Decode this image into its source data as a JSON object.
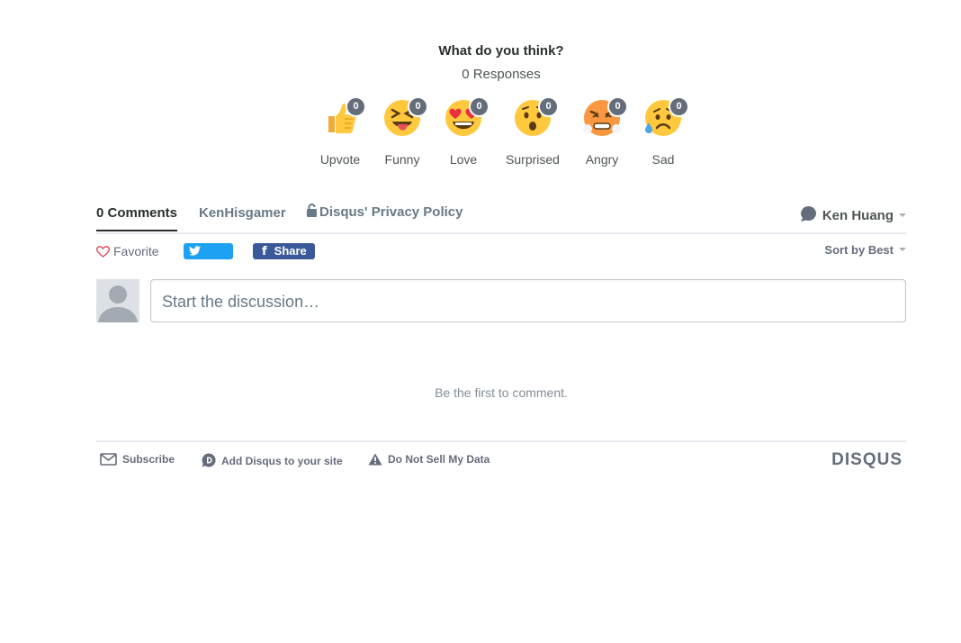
{
  "reactions": {
    "title": "What do you think?",
    "responses": "0 Responses",
    "items": [
      {
        "label": "Upvote",
        "count": "0",
        "icon": "thumbs-up-emoji"
      },
      {
        "label": "Funny",
        "count": "0",
        "icon": "tongue-squint-emoji"
      },
      {
        "label": "Love",
        "count": "0",
        "icon": "heart-eyes-emoji"
      },
      {
        "label": "Surprised",
        "count": "0",
        "icon": "surprised-emoji"
      },
      {
        "label": "Angry",
        "count": "0",
        "icon": "angry-emoji"
      },
      {
        "label": "Sad",
        "count": "0",
        "icon": "sad-sweat-emoji"
      }
    ]
  },
  "nav": {
    "comments_tab": "0 Comments",
    "community_tab": "KenHisgamer",
    "privacy_tab": "Disqus' Privacy Policy",
    "user_name": "Ken Huang"
  },
  "toolbar": {
    "favorite": "Favorite",
    "tweet": "Tweet",
    "share": "Share",
    "sort": "Sort by Best"
  },
  "composer": {
    "placeholder": "Start the discussion…"
  },
  "empty_message": "Be the first to comment.",
  "footer": {
    "subscribe": "Subscribe",
    "add_disqus": "Add Disqus to your site",
    "do_not_sell": "Do Not Sell My Data",
    "brand": "DISQUS"
  },
  "colors": {
    "tweet": "#1da1f2",
    "facebook": "#3b5998",
    "badge": "#656c7a",
    "emoji_yellow": "#ffc83d"
  }
}
